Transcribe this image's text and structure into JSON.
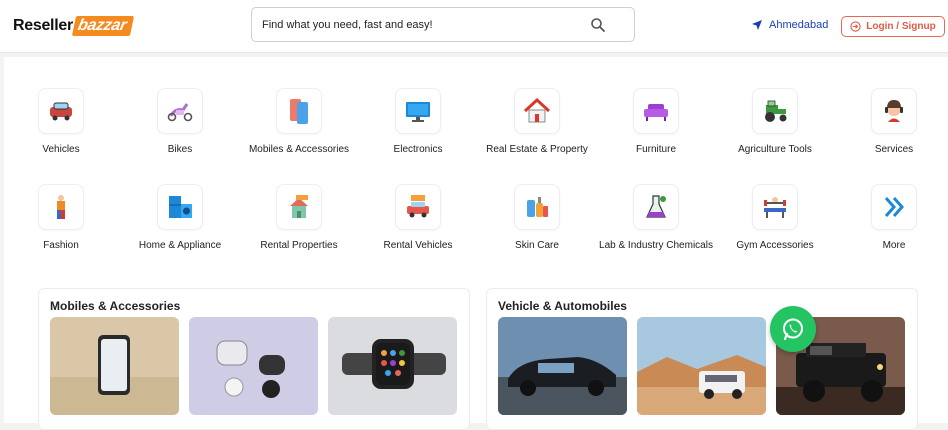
{
  "header": {
    "logo_part1": "Reseller",
    "logo_part2": "bazzar",
    "search_placeholder": "Find what you need, fast and easy!",
    "location": "Ahmedabad",
    "login_label": "Login / Signup"
  },
  "categories_row1": [
    {
      "label": "Vehicles",
      "icon": "car-icon"
    },
    {
      "label": "Bikes",
      "icon": "scooter-icon"
    },
    {
      "label": "Mobiles & Accessories",
      "icon": "mobile-icon"
    },
    {
      "label": "Electronics",
      "icon": "monitor-icon"
    },
    {
      "label": "Real Estate & Property",
      "icon": "house-icon"
    },
    {
      "label": "Furniture",
      "icon": "sofa-icon"
    },
    {
      "label": "Agriculture Tools",
      "icon": "tractor-icon"
    },
    {
      "label": "Services",
      "icon": "headset-icon"
    }
  ],
  "categories_row2": [
    {
      "label": "Fashion",
      "icon": "fashion-icon"
    },
    {
      "label": "Home & Appliance",
      "icon": "appliance-icon"
    },
    {
      "label": "Rental Properties",
      "icon": "rental-property-icon"
    },
    {
      "label": "Rental Vehicles",
      "icon": "rental-vehicle-icon"
    },
    {
      "label": "Skin Care",
      "icon": "skincare-icon"
    },
    {
      "label": "Lab & Industry Chemicals",
      "icon": "lab-icon"
    },
    {
      "label": "Gym Accessories",
      "icon": "gym-icon"
    },
    {
      "label": "More",
      "icon": "chevron-double-right-icon"
    }
  ],
  "panels": {
    "mobiles_title": "Mobiles & Accessories",
    "vehicles_title": "Vehicle & Automobiles"
  },
  "colors": {
    "brand_orange": "#f58a1f",
    "login_red": "#e05b45",
    "location_blue": "#1a3fb8",
    "whatsapp_green": "#25c463"
  }
}
